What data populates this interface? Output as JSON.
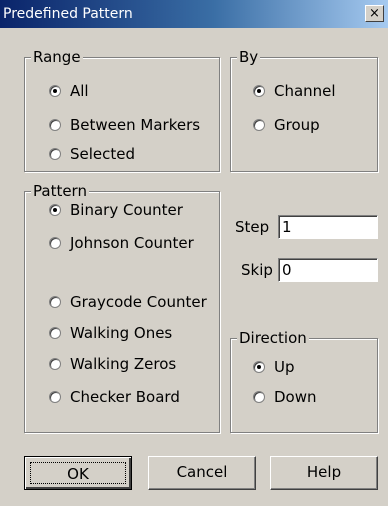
{
  "window": {
    "title": "Predefined Pattern",
    "close_glyph": "×"
  },
  "range": {
    "legend": "Range",
    "options": [
      {
        "label": "All",
        "checked": true
      },
      {
        "label": "Between Markers",
        "checked": false
      },
      {
        "label": "Selected",
        "checked": false
      }
    ]
  },
  "by": {
    "legend": "By",
    "options": [
      {
        "label": "Channel",
        "checked": true
      },
      {
        "label": "Group",
        "checked": false
      }
    ]
  },
  "pattern": {
    "legend": "Pattern",
    "options": [
      {
        "label": "Binary Counter",
        "checked": true
      },
      {
        "label": "Johnson Counter",
        "checked": false
      },
      {
        "label": "Graycode Counter",
        "checked": false
      },
      {
        "label": "Walking Ones",
        "checked": false
      },
      {
        "label": "Walking Zeros",
        "checked": false
      },
      {
        "label": "Checker Board",
        "checked": false
      }
    ]
  },
  "step": {
    "label": "Step",
    "value": "1"
  },
  "skip": {
    "label": "Skip",
    "value": "0"
  },
  "direction": {
    "legend": "Direction",
    "options": [
      {
        "label": "Up",
        "checked": true
      },
      {
        "label": "Down",
        "checked": false
      }
    ]
  },
  "buttons": {
    "ok": "OK",
    "cancel": "Cancel",
    "help": "Help"
  }
}
